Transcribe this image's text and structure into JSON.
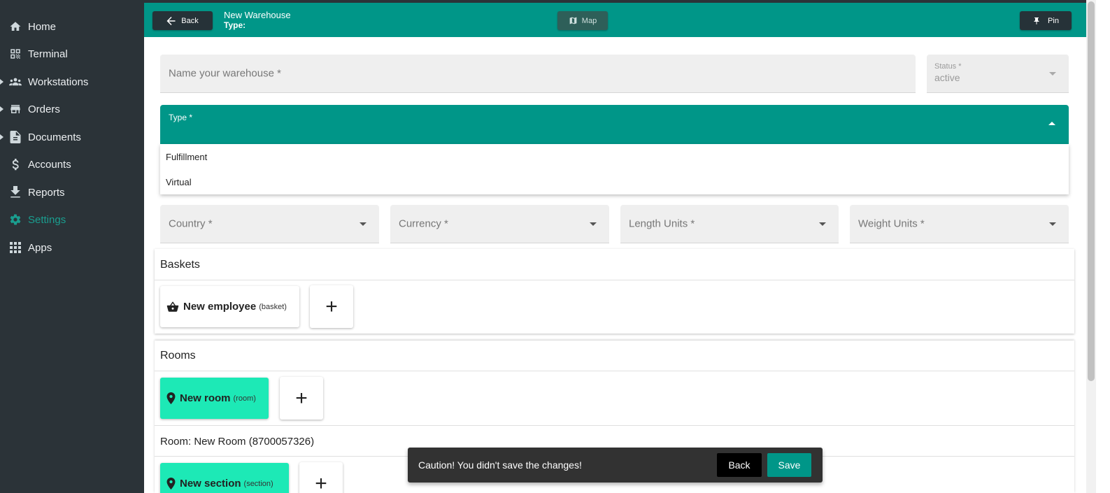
{
  "sidebar": {
    "items": [
      {
        "label": "Home",
        "icon": "home-icon"
      },
      {
        "label": "Terminal",
        "icon": "qr-code-icon"
      },
      {
        "label": "Workstations",
        "icon": "group-icon"
      },
      {
        "label": "Orders",
        "icon": "store-icon"
      },
      {
        "label": "Documents",
        "icon": "document-icon"
      },
      {
        "label": "Accounts",
        "icon": "dollar-icon"
      },
      {
        "label": "Reports",
        "icon": "download-icon"
      },
      {
        "label": "Settings",
        "icon": "gear-icon"
      },
      {
        "label": "Apps",
        "icon": "apps-grid-icon"
      }
    ],
    "active_color": "#1a9e8f"
  },
  "header": {
    "back_label": "Back",
    "title": "New Warehouse",
    "subtitle": "Type:",
    "map_label": "Map",
    "pin_label": "Pin",
    "color": "#009688"
  },
  "form": {
    "name_placeholder": "Name your warehouse *",
    "status_label": "Status *",
    "status_value": "active",
    "type_label": "Type *",
    "type_options": [
      "Fulfillment",
      "Virtual"
    ],
    "country_placeholder": "Country *",
    "currency_placeholder": "Currency *",
    "length_placeholder": "Length Units *",
    "weight_placeholder": "Weight Units *"
  },
  "baskets": {
    "title": "Baskets",
    "card_name": "New employee",
    "card_type": "(basket)"
  },
  "rooms": {
    "title": "Rooms",
    "card_name": "New room",
    "card_type": "(room)",
    "room_heading": "Room: New Room (8700057326)",
    "section_name": "New section",
    "section_type": "(section)"
  },
  "plus_symbol": "+",
  "snackbar": {
    "message": "Caution! You didn't save the changes!",
    "back_label": "Back",
    "save_label": "Save"
  }
}
